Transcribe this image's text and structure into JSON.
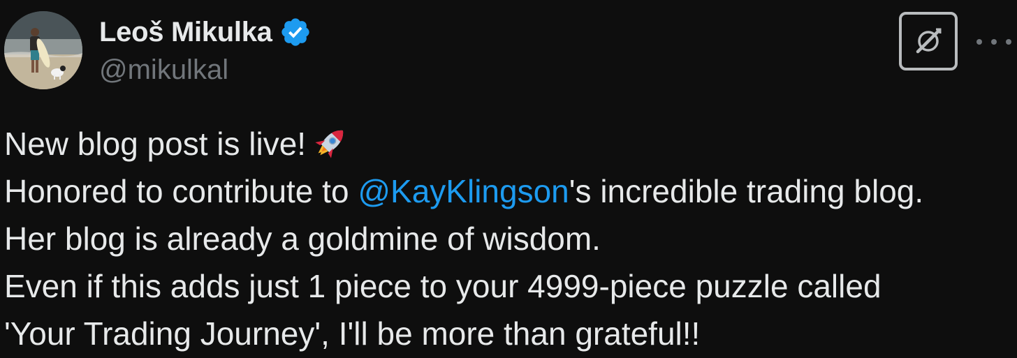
{
  "author": {
    "display_name": "Leoš Mikulka",
    "handle": "@mikulkal",
    "verified": true,
    "avatar_icon": "avatar-photo-surfer-with-dog"
  },
  "actions": {
    "x_icon": "x-logo-icon",
    "more_icon": "more-horizontal-icon"
  },
  "tweet": {
    "line1_text": "New blog post is live!",
    "line1_emoji": "rocket-emoji",
    "line2_before": "Honored to contribute to ",
    "line2_mention": "@KayKlingson",
    "line2_after": "'s incredible trading blog.",
    "line3": "Her blog is already a goldmine of wisdom.",
    "line4": "Even if this adds just 1 piece to your 4999-piece puzzle called",
    "line5": "'Your Trading Journey', I'll be more than grateful!!"
  },
  "colors": {
    "background": "#0e0e0e",
    "text": "#e7e9ea",
    "muted": "#71767b",
    "mention": "#1d9bf0",
    "verified_badge": "#1d9bf0"
  }
}
